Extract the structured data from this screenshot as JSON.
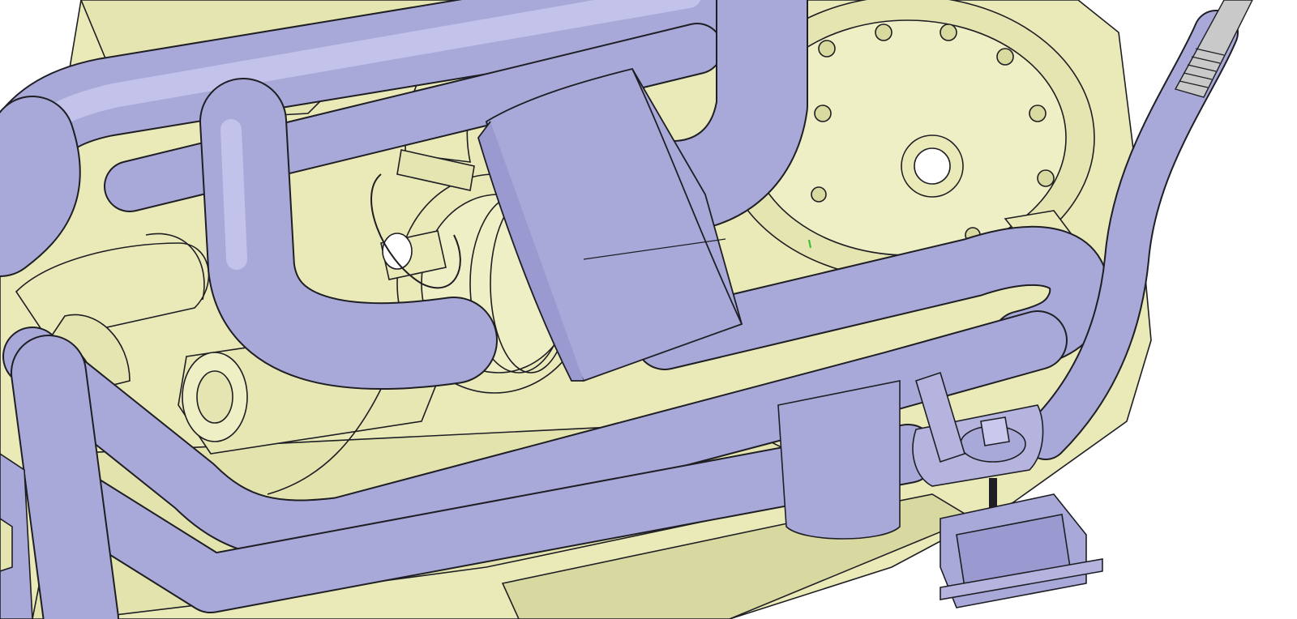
{
  "viewport": {
    "background": "#ffffff",
    "content": "cad-model-render"
  },
  "colors": {
    "engine_body": "#e9eab8",
    "engine_shade": "#cfd09a",
    "pipe": "#a9a9d9",
    "pipe_light": "#c9c9ee",
    "pipe_dark": "#8d8dc2",
    "outline": "#1e1e24",
    "highlight_mark": "#30c030"
  },
  "parts": {
    "engine_block": "engine-block",
    "turbocharger": "turbocharger",
    "coolant_pipes": "coolant-pipe-loop",
    "heat_shield": "heat-shield-sleeve",
    "engine_mount": "engine-mount",
    "flexible_hose": "flexible-hose"
  }
}
